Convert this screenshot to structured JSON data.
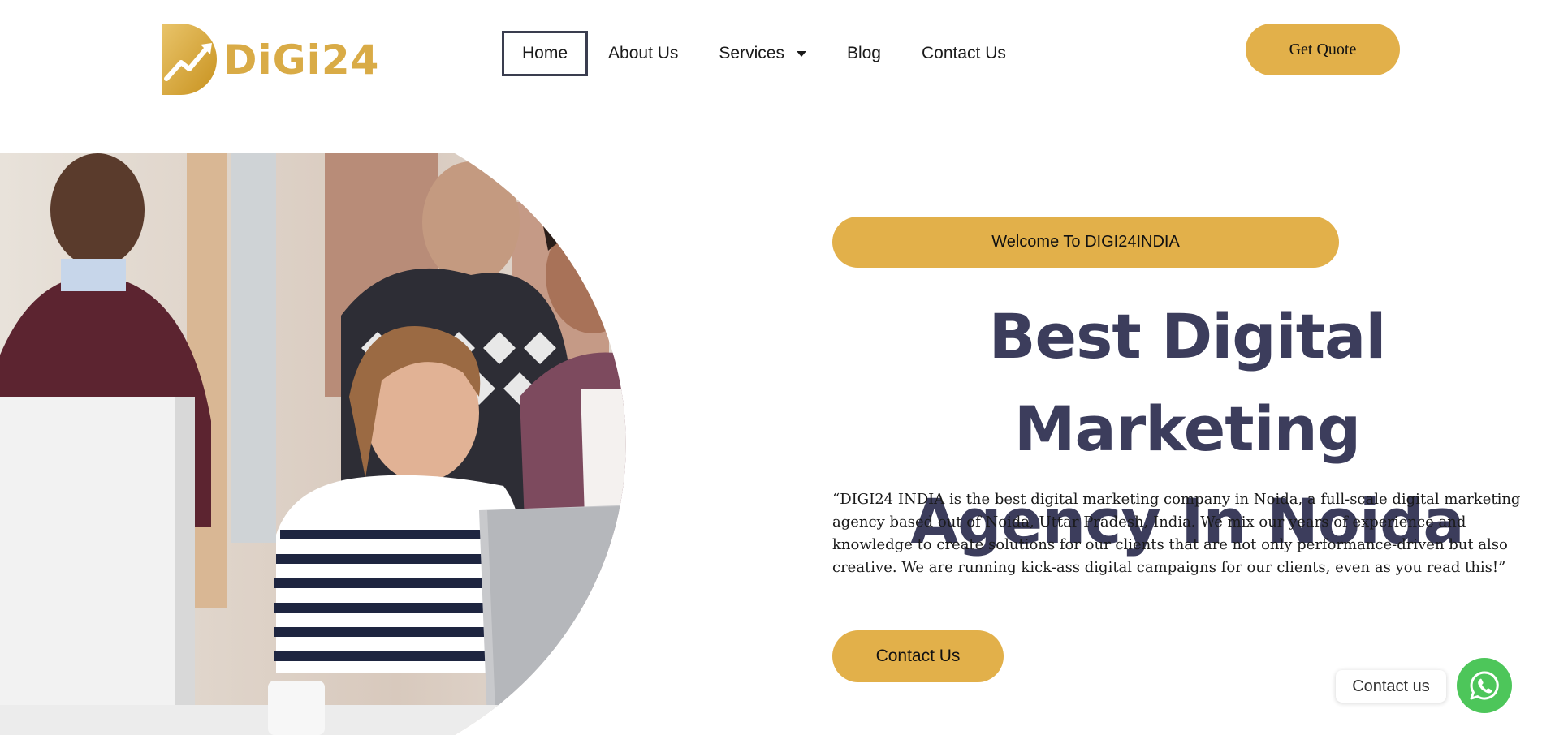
{
  "brand": {
    "logo_text": "DiGi24",
    "gold": "#e2b04a",
    "title_color": "#3c3d5c"
  },
  "nav": {
    "items": [
      {
        "label": "Home",
        "active": true
      },
      {
        "label": "About Us"
      },
      {
        "label": "Services",
        "has_dropdown": true
      },
      {
        "label": "Blog"
      },
      {
        "label": "Contact Us"
      }
    ],
    "cta_label": "Get Quote"
  },
  "hero": {
    "welcome": "Welcome To DIGI24INDIA",
    "title_line1": "Best Digital Marketing",
    "title_line2": "Agency In Noida",
    "description": "“DIGI24 INDIA is the best digital marketing company in Noida, a full-scale digital marketing agency based out of Noida, Uttar Pradesh, India. We mix our years of experience and knowledge to create solutions for our clients that are not only performance-driven but also creative. We are running kick-ass digital campaigns for our clients, even as you read this!”",
    "contact_label": "Contact Us"
  },
  "whatsapp": {
    "label": "Contact us",
    "icon": "whatsapp-icon",
    "color": "#4dc65a"
  }
}
